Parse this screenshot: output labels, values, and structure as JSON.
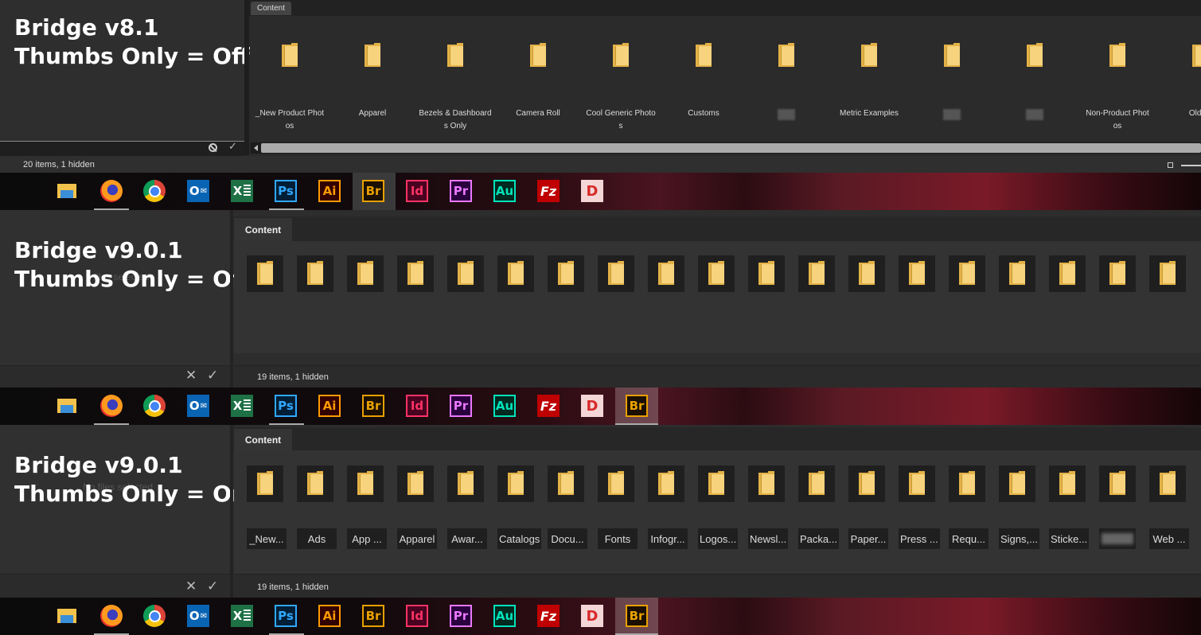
{
  "section1": {
    "title_line1": "Bridge v8.1",
    "title_line2": "Thumbs Only = Off",
    "tab": "Content",
    "status": "20 items, 1 hidden",
    "folders": [
      {
        "l1": "_New Product Phot",
        "l2": "os"
      },
      {
        "l1": "Apparel",
        "l2": ""
      },
      {
        "l1": "Bezels & Dashboard",
        "l2": "s Only"
      },
      {
        "l1": "Camera Roll",
        "l2": ""
      },
      {
        "l1": "Cool Generic Photo",
        "l2": "s"
      },
      {
        "l1": "Customs",
        "l2": ""
      },
      {
        "l1": "",
        "l2": ""
      },
      {
        "l1": "Metric Examples",
        "l2": ""
      },
      {
        "l1": "",
        "l2": ""
      },
      {
        "l1": "",
        "l2": ""
      },
      {
        "l1": "Non-Product Phot",
        "l2": "os"
      },
      {
        "l1": "Old Pr",
        "l2": ""
      }
    ]
  },
  "section2": {
    "title_line1": "Bridge v9.0.1",
    "title_line2": "Thumbs Only = Off",
    "ghost": "files selected",
    "tab": "Content",
    "status": "19 items, 1 hidden",
    "folder_count": 19
  },
  "section3": {
    "title_line1": "Bridge v9.0.1",
    "title_line2": "Thumbs Only = On",
    "ghost": "No files selected",
    "tab": "Content",
    "status": "19 items, 1 hidden",
    "labels": [
      "_New...",
      "Ads",
      "App ...",
      "Apparel",
      "Awar...",
      "Catalogs",
      "Docu...",
      "Fonts",
      "Infogr...",
      "Logos...",
      "Newsl...",
      "Packa...",
      "Paper...",
      "Press ...",
      "Requ...",
      "Signs,...",
      "Sticke...",
      "",
      "Web ..."
    ]
  },
  "taskbar": {
    "icons": [
      "windows-icon",
      "file-explorer-icon",
      "firefox-icon",
      "chrome-icon",
      "outlook-icon",
      "excel-icon",
      "photoshop-icon",
      "illustrator-icon",
      "bridge-icon",
      "indesign-icon",
      "premiere-icon",
      "audition-icon",
      "filezilla-icon",
      "dreamweaver-icon"
    ],
    "ps": "Ps",
    "ai": "Ai",
    "br": "Br",
    "id": "Id",
    "pr": "Pr",
    "au": "Au",
    "fz": "Fz",
    "d": "D",
    "outlook": "O",
    "excel": "X"
  },
  "colors": {
    "ps": "#31a8ff",
    "ai": "#ff9a00",
    "br": "#e8a000",
    "id": "#ff3366",
    "pr": "#ea77ff",
    "au": "#00e4bb",
    "fz": "#bf0000"
  }
}
